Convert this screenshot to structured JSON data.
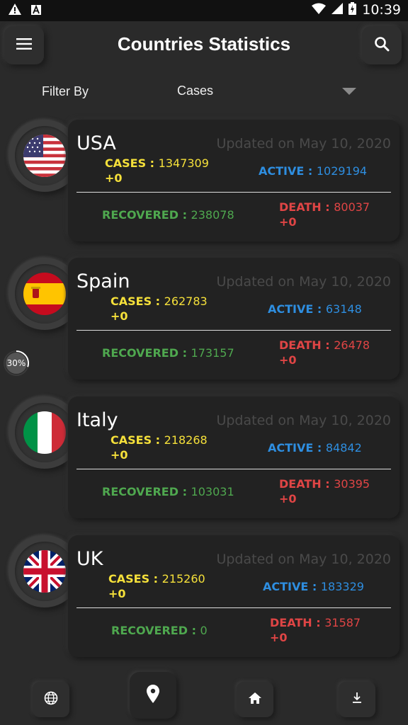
{
  "status_bar": {
    "time": "10:39",
    "icons": [
      "warning-icon",
      "a-notification-icon",
      "wifi-icon",
      "signal-icon",
      "battery-charging-icon"
    ]
  },
  "header": {
    "title": "Countries Statistics",
    "menu_icon": "hamburger-menu-icon",
    "search_icon": "search-icon"
  },
  "filter": {
    "label": "Filter By",
    "selected": "Cases"
  },
  "labels": {
    "cases": "CASES : ",
    "active": "ACTIVE : ",
    "recovered": "RECOVERED : ",
    "death": "DEATH : "
  },
  "countries": [
    {
      "name": "USA",
      "updated": "Updated on May 10, 2020",
      "cases": "1347309",
      "cases_delta": "+0",
      "active": "1029194",
      "recovered": "238078",
      "death": "80037",
      "death_delta": "+0",
      "flag": "usa-flag-icon"
    },
    {
      "name": "Spain",
      "updated": "Updated on May 10, 2020",
      "cases": "262783",
      "cases_delta": "+0",
      "active": "63148",
      "recovered": "173157",
      "death": "26478",
      "death_delta": "+0",
      "flag": "spain-flag-icon"
    },
    {
      "name": "Italy",
      "updated": "Updated on May 10, 2020",
      "cases": "218268",
      "cases_delta": "+0",
      "active": "84842",
      "recovered": "103031",
      "death": "30395",
      "death_delta": "+0",
      "flag": "italy-flag-icon"
    },
    {
      "name": "UK",
      "updated": "Updated on May 10, 2020",
      "cases": "215260",
      "cases_delta": "+0",
      "active": "183329",
      "recovered": "0",
      "death": "31587",
      "death_delta": "+0",
      "flag": "uk-flag-icon"
    }
  ],
  "loading": {
    "progress_text": "30%",
    "progress_fraction": 0.3
  },
  "bottom_nav": [
    "globe-icon",
    "location-pin-icon",
    "home-icon",
    "download-icon"
  ],
  "colors": {
    "background": "#2a2a2a",
    "cases": "#f5e03a",
    "active": "#2e8ee0",
    "recovered": "#4fa84f",
    "death": "#e04545"
  }
}
